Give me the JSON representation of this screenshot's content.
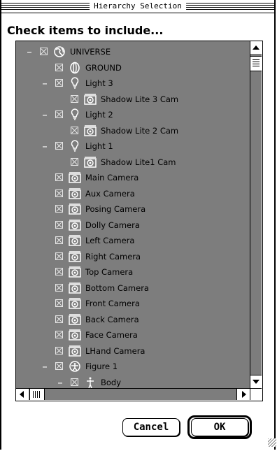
{
  "window": {
    "title": "Hierarchy Selection"
  },
  "instruction": "Check items to include...",
  "tree": [
    {
      "label": "UNIVERSE",
      "icon": "globe-icon",
      "indent": 0,
      "twisty": true,
      "checked": true
    },
    {
      "label": "GROUND",
      "icon": "ground-icon",
      "indent": 1,
      "twisty": false,
      "checked": true
    },
    {
      "label": "Light 3",
      "icon": "light-bulb-icon",
      "indent": 1,
      "twisty": true,
      "checked": true
    },
    {
      "label": "Shadow Lite 3 Cam",
      "icon": "camera-icon",
      "indent": 2,
      "twisty": false,
      "checked": true
    },
    {
      "label": "Light 2",
      "icon": "light-bulb-icon",
      "indent": 1,
      "twisty": true,
      "checked": true
    },
    {
      "label": "Shadow Lite 2 Cam",
      "icon": "camera-icon",
      "indent": 2,
      "twisty": false,
      "checked": true
    },
    {
      "label": "Light 1",
      "icon": "light-bulb-icon",
      "indent": 1,
      "twisty": true,
      "checked": true
    },
    {
      "label": "Shadow Lite1 Cam",
      "icon": "camera-icon",
      "indent": 2,
      "twisty": false,
      "checked": true
    },
    {
      "label": "Main Camera",
      "icon": "camera-icon",
      "indent": 1,
      "twisty": false,
      "checked": true
    },
    {
      "label": "Aux Camera",
      "icon": "camera-icon",
      "indent": 1,
      "twisty": false,
      "checked": true
    },
    {
      "label": "Posing Camera",
      "icon": "camera-icon",
      "indent": 1,
      "twisty": false,
      "checked": true
    },
    {
      "label": "Dolly Camera",
      "icon": "camera-icon",
      "indent": 1,
      "twisty": false,
      "checked": true
    },
    {
      "label": "Left Camera",
      "icon": "camera-icon",
      "indent": 1,
      "twisty": false,
      "checked": true
    },
    {
      "label": "Right Camera",
      "icon": "camera-icon",
      "indent": 1,
      "twisty": false,
      "checked": true
    },
    {
      "label": "Top Camera",
      "icon": "camera-icon",
      "indent": 1,
      "twisty": false,
      "checked": true
    },
    {
      "label": "Bottom Camera",
      "icon": "camera-icon",
      "indent": 1,
      "twisty": false,
      "checked": true
    },
    {
      "label": "Front Camera",
      "icon": "camera-icon",
      "indent": 1,
      "twisty": false,
      "checked": true
    },
    {
      "label": "Back Camera",
      "icon": "camera-icon",
      "indent": 1,
      "twisty": false,
      "checked": true
    },
    {
      "label": "Face Camera",
      "icon": "camera-icon",
      "indent": 1,
      "twisty": false,
      "checked": true
    },
    {
      "label": "LHand Camera",
      "icon": "camera-icon",
      "indent": 1,
      "twisty": false,
      "checked": true
    },
    {
      "label": "Figure 1",
      "icon": "figure-icon",
      "indent": 1,
      "twisty": true,
      "checked": true
    },
    {
      "label": "Body",
      "icon": "body-icon",
      "indent": 2,
      "twisty": true,
      "checked": true
    }
  ],
  "buttons": {
    "cancel": "Cancel",
    "ok": "OK"
  },
  "colors": {
    "list_background": "#7d7d7d",
    "label": "#000000",
    "glyph": "#ffffff"
  }
}
